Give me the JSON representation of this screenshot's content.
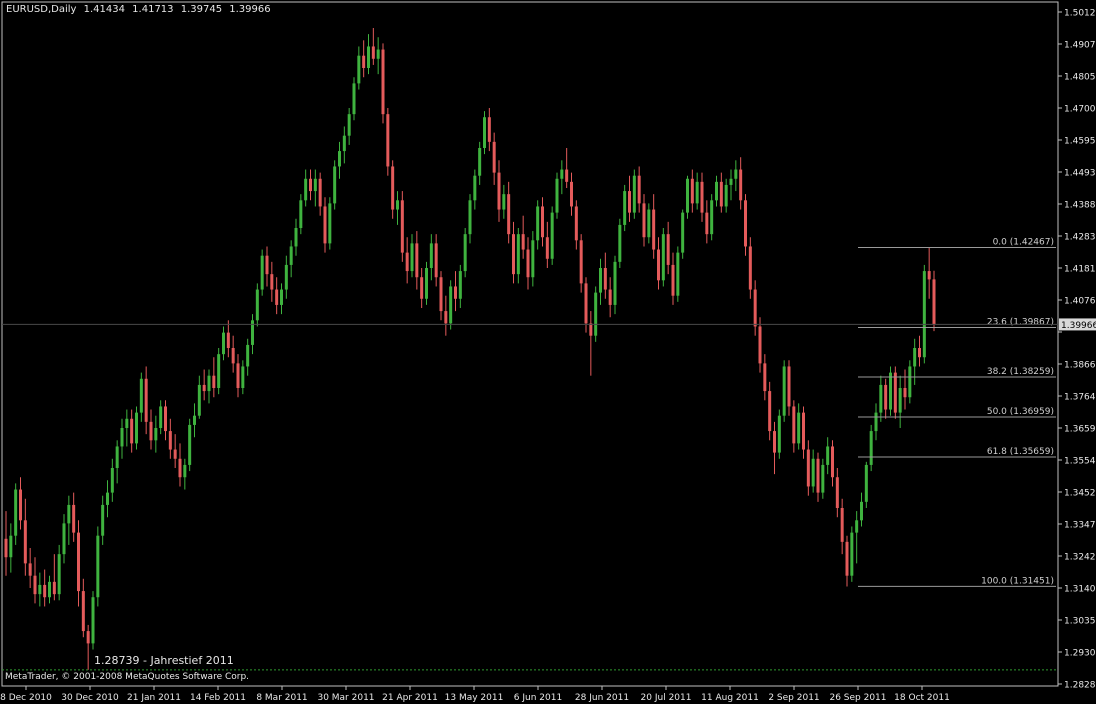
{
  "header": {
    "symbol": "EURUSD,Daily",
    "open": "1.41434",
    "high": "1.41713",
    "low": "1.39745",
    "close": "1.39966"
  },
  "footer": {
    "copyright": "MetaTrader, © 2001-2008 MetaQuotes Software Corp."
  },
  "annotation": {
    "low_label": "1.28739 - Jahrestief 2011"
  },
  "colors": {
    "background": "#000000",
    "bull": "#3fb33f",
    "bear": "#e45b5b",
    "axis": "#c0c0c0",
    "text": "#e8e8e8",
    "fib": "#9a9a9a"
  },
  "chart_data": {
    "type": "candlestick",
    "title": "EURUSD,Daily",
    "ylim": [
      1.2828,
      1.5012
    ],
    "y_ticks": [
      "1.50120",
      "1.49070",
      "1.48050",
      "1.47000",
      "1.45950",
      "1.44930",
      "1.43880",
      "1.42830",
      "1.41810",
      "1.40760",
      "1.39710",
      "1.38660",
      "1.37640",
      "1.36590",
      "1.35540",
      "1.34520",
      "1.33470",
      "1.32420",
      "1.31400",
      "1.30350",
      "1.29300",
      "1.28280"
    ],
    "x_ticks": [
      "8 Dec 2010",
      "30 Dec 2010",
      "21 Jan 2011",
      "14 Feb 2011",
      "8 Mar 2011",
      "30 Mar 2011",
      "21 Apr 2011",
      "13 May 2011",
      "6 Jun 2011",
      "28 Jun 2011",
      "20 Jul 2011",
      "11 Aug 2011",
      "2 Sep 2011",
      "26 Sep 2011",
      "18 Oct 2011"
    ],
    "current_price": "1.39966",
    "ohlc": [
      [
        1.33,
        1.339,
        1.318,
        1.324
      ],
      [
        1.324,
        1.335,
        1.319,
        1.331
      ],
      [
        1.331,
        1.348,
        1.328,
        1.346
      ],
      [
        1.346,
        1.35,
        1.333,
        1.336
      ],
      [
        1.336,
        1.343,
        1.318,
        1.322
      ],
      [
        1.322,
        1.327,
        1.314,
        1.318
      ],
      [
        1.318,
        1.324,
        1.309,
        1.312
      ],
      [
        1.312,
        1.319,
        1.308,
        1.315
      ],
      [
        1.315,
        1.32,
        1.308,
        1.311
      ],
      [
        1.311,
        1.318,
        1.309,
        1.316
      ],
      [
        1.316,
        1.325,
        1.31,
        1.312
      ],
      [
        1.312,
        1.328,
        1.31,
        1.325
      ],
      [
        1.325,
        1.338,
        1.322,
        1.335
      ],
      [
        1.335,
        1.344,
        1.328,
        1.341
      ],
      [
        1.341,
        1.345,
        1.329,
        1.332
      ],
      [
        1.332,
        1.336,
        1.308,
        1.313
      ],
      [
        1.313,
        1.317,
        1.298,
        1.3
      ],
      [
        1.3,
        1.302,
        1.2874,
        1.296
      ],
      [
        1.296,
        1.313,
        1.294,
        1.311
      ],
      [
        1.311,
        1.334,
        1.308,
        1.331
      ],
      [
        1.331,
        1.344,
        1.328,
        1.341
      ],
      [
        1.341,
        1.349,
        1.337,
        1.345
      ],
      [
        1.345,
        1.356,
        1.342,
        1.353
      ],
      [
        1.353,
        1.362,
        1.348,
        1.36
      ],
      [
        1.36,
        1.369,
        1.356,
        1.366
      ],
      [
        1.366,
        1.372,
        1.36,
        1.369
      ],
      [
        1.369,
        1.372,
        1.358,
        1.361
      ],
      [
        1.361,
        1.373,
        1.359,
        1.371
      ],
      [
        1.371,
        1.384,
        1.368,
        1.382
      ],
      [
        1.382,
        1.386,
        1.364,
        1.368
      ],
      [
        1.368,
        1.372,
        1.359,
        1.362
      ],
      [
        1.362,
        1.37,
        1.358,
        1.366
      ],
      [
        1.366,
        1.375,
        1.364,
        1.373
      ],
      [
        1.373,
        1.375,
        1.362,
        1.365
      ],
      [
        1.365,
        1.369,
        1.356,
        1.359
      ],
      [
        1.359,
        1.364,
        1.353,
        1.356
      ],
      [
        1.356,
        1.361,
        1.347,
        1.35
      ],
      [
        1.35,
        1.356,
        1.346,
        1.354
      ],
      [
        1.354,
        1.369,
        1.352,
        1.367
      ],
      [
        1.367,
        1.374,
        1.363,
        1.37
      ],
      [
        1.37,
        1.383,
        1.369,
        1.38
      ],
      [
        1.38,
        1.385,
        1.375,
        1.378
      ],
      [
        1.378,
        1.385,
        1.374,
        1.383
      ],
      [
        1.383,
        1.389,
        1.376,
        1.379
      ],
      [
        1.379,
        1.392,
        1.377,
        1.39
      ],
      [
        1.39,
        1.399,
        1.388,
        1.397
      ],
      [
        1.397,
        1.401,
        1.389,
        1.392
      ],
      [
        1.392,
        1.396,
        1.384,
        1.387
      ],
      [
        1.387,
        1.39,
        1.376,
        1.379
      ],
      [
        1.379,
        1.388,
        1.377,
        1.386
      ],
      [
        1.386,
        1.395,
        1.383,
        1.393
      ],
      [
        1.393,
        1.403,
        1.39,
        1.401
      ],
      [
        1.401,
        1.413,
        1.399,
        1.411
      ],
      [
        1.411,
        1.424,
        1.409,
        1.422
      ],
      [
        1.422,
        1.425,
        1.412,
        1.416
      ],
      [
        1.416,
        1.42,
        1.407,
        1.411
      ],
      [
        1.411,
        1.415,
        1.403,
        1.406
      ],
      [
        1.406,
        1.413,
        1.403,
        1.411
      ],
      [
        1.411,
        1.422,
        1.408,
        1.419
      ],
      [
        1.419,
        1.427,
        1.415,
        1.425
      ],
      [
        1.425,
        1.434,
        1.422,
        1.431
      ],
      [
        1.431,
        1.442,
        1.429,
        1.44
      ],
      [
        1.44,
        1.45,
        1.438,
        1.447
      ],
      [
        1.447,
        1.45,
        1.44,
        1.443
      ],
      [
        1.443,
        1.45,
        1.438,
        1.447
      ],
      [
        1.447,
        1.449,
        1.435,
        1.438
      ],
      [
        1.438,
        1.441,
        1.423,
        1.426
      ],
      [
        1.426,
        1.441,
        1.424,
        1.439
      ],
      [
        1.439,
        1.453,
        1.437,
        1.451
      ],
      [
        1.451,
        1.459,
        1.447,
        1.456
      ],
      [
        1.456,
        1.464,
        1.452,
        1.461
      ],
      [
        1.461,
        1.47,
        1.458,
        1.468
      ],
      [
        1.468,
        1.48,
        1.466,
        1.478
      ],
      [
        1.478,
        1.49,
        1.476,
        1.487
      ],
      [
        1.487,
        1.492,
        1.48,
        1.483
      ],
      [
        1.483,
        1.494,
        1.481,
        1.49
      ],
      [
        1.49,
        1.496,
        1.484,
        1.486
      ],
      [
        1.486,
        1.493,
        1.481,
        1.489
      ],
      [
        1.489,
        1.491,
        1.465,
        1.468
      ],
      [
        1.468,
        1.47,
        1.448,
        1.451
      ],
      [
        1.451,
        1.453,
        1.434,
        1.437
      ],
      [
        1.437,
        1.443,
        1.432,
        1.44
      ],
      [
        1.44,
        1.443,
        1.42,
        1.423
      ],
      [
        1.423,
        1.428,
        1.413,
        1.417
      ],
      [
        1.417,
        1.429,
        1.415,
        1.426
      ],
      [
        1.426,
        1.43,
        1.411,
        1.415
      ],
      [
        1.415,
        1.418,
        1.405,
        1.408
      ],
      [
        1.408,
        1.42,
        1.406,
        1.418
      ],
      [
        1.418,
        1.429,
        1.414,
        1.426
      ],
      [
        1.426,
        1.429,
        1.412,
        1.415
      ],
      [
        1.415,
        1.417,
        1.401,
        1.404
      ],
      [
        1.404,
        1.409,
        1.396,
        1.4
      ],
      [
        1.4,
        1.414,
        1.398,
        1.412
      ],
      [
        1.412,
        1.417,
        1.404,
        1.408
      ],
      [
        1.408,
        1.419,
        1.405,
        1.417
      ],
      [
        1.417,
        1.431,
        1.415,
        1.429
      ],
      [
        1.429,
        1.442,
        1.426,
        1.44
      ],
      [
        1.44,
        1.45,
        1.437,
        1.448
      ],
      [
        1.448,
        1.459,
        1.445,
        1.457
      ],
      [
        1.457,
        1.469,
        1.455,
        1.467
      ],
      [
        1.467,
        1.47,
        1.456,
        1.459
      ],
      [
        1.459,
        1.462,
        1.445,
        1.449
      ],
      [
        1.449,
        1.453,
        1.433,
        1.437
      ],
      [
        1.437,
        1.445,
        1.434,
        1.442
      ],
      [
        1.442,
        1.446,
        1.426,
        1.429
      ],
      [
        1.429,
        1.433,
        1.413,
        1.416
      ],
      [
        1.416,
        1.431,
        1.413,
        1.429
      ],
      [
        1.429,
        1.435,
        1.421,
        1.424
      ],
      [
        1.424,
        1.428,
        1.411,
        1.415
      ],
      [
        1.415,
        1.43,
        1.412,
        1.427
      ],
      [
        1.427,
        1.44,
        1.424,
        1.438
      ],
      [
        1.438,
        1.441,
        1.425,
        1.428
      ],
      [
        1.428,
        1.433,
        1.418,
        1.421
      ],
      [
        1.421,
        1.438,
        1.419,
        1.436
      ],
      [
        1.436,
        1.449,
        1.434,
        1.447
      ],
      [
        1.447,
        1.453,
        1.442,
        1.45
      ],
      [
        1.45,
        1.457,
        1.444,
        1.446
      ],
      [
        1.446,
        1.449,
        1.435,
        1.438
      ],
      [
        1.438,
        1.44,
        1.424,
        1.427
      ],
      [
        1.427,
        1.429,
        1.41,
        1.413
      ],
      [
        1.413,
        1.415,
        1.397,
        1.4
      ],
      [
        1.4,
        1.404,
        1.383,
        1.396
      ],
      [
        1.396,
        1.412,
        1.394,
        1.41
      ],
      [
        1.41,
        1.421,
        1.406,
        1.418
      ],
      [
        1.418,
        1.423,
        1.408,
        1.411
      ],
      [
        1.411,
        1.415,
        1.402,
        1.406
      ],
      [
        1.406,
        1.422,
        1.403,
        1.42
      ],
      [
        1.42,
        1.434,
        1.418,
        1.432
      ],
      [
        1.432,
        1.445,
        1.43,
        1.443
      ],
      [
        1.443,
        1.448,
        1.433,
        1.436
      ],
      [
        1.436,
        1.45,
        1.434,
        1.448
      ],
      [
        1.448,
        1.451,
        1.436,
        1.439
      ],
      [
        1.439,
        1.442,
        1.425,
        1.428
      ],
      [
        1.428,
        1.439,
        1.426,
        1.437
      ],
      [
        1.437,
        1.442,
        1.421,
        1.424
      ],
      [
        1.424,
        1.428,
        1.411,
        1.414
      ],
      [
        1.414,
        1.431,
        1.412,
        1.429
      ],
      [
        1.429,
        1.433,
        1.416,
        1.419
      ],
      [
        1.419,
        1.423,
        1.406,
        1.409
      ],
      [
        1.409,
        1.425,
        1.407,
        1.423
      ],
      [
        1.423,
        1.437,
        1.421,
        1.436
      ],
      [
        1.436,
        1.448,
        1.434,
        1.447
      ],
      [
        1.447,
        1.45,
        1.436,
        1.439
      ],
      [
        1.439,
        1.449,
        1.437,
        1.446
      ],
      [
        1.446,
        1.449,
        1.433,
        1.436
      ],
      [
        1.436,
        1.44,
        1.426,
        1.429
      ],
      [
        1.429,
        1.442,
        1.427,
        1.44
      ],
      [
        1.44,
        1.448,
        1.438,
        1.446
      ],
      [
        1.446,
        1.449,
        1.436,
        1.438
      ],
      [
        1.438,
        1.447,
        1.436,
        1.445
      ],
      [
        1.445,
        1.45,
        1.44,
        1.447
      ],
      [
        1.447,
        1.453,
        1.443,
        1.45
      ],
      [
        1.45,
        1.454,
        1.437,
        1.44
      ],
      [
        1.44,
        1.442,
        1.422,
        1.425
      ],
      [
        1.425,
        1.428,
        1.408,
        1.411
      ],
      [
        1.411,
        1.414,
        1.396,
        1.399
      ],
      [
        1.399,
        1.402,
        1.384,
        1.387
      ],
      [
        1.387,
        1.39,
        1.375,
        1.378
      ],
      [
        1.378,
        1.381,
        1.362,
        1.365
      ],
      [
        1.365,
        1.368,
        1.351,
        1.358
      ],
      [
        1.358,
        1.372,
        1.356,
        1.37
      ],
      [
        1.37,
        1.388,
        1.368,
        1.386
      ],
      [
        1.386,
        1.388,
        1.37,
        1.373
      ],
      [
        1.373,
        1.375,
        1.358,
        1.361
      ],
      [
        1.361,
        1.374,
        1.359,
        1.371
      ],
      [
        1.371,
        1.373,
        1.356,
        1.359
      ],
      [
        1.359,
        1.362,
        1.344,
        1.347
      ],
      [
        1.347,
        1.359,
        1.345,
        1.356
      ],
      [
        1.356,
        1.358,
        1.342,
        1.345
      ],
      [
        1.345,
        1.356,
        1.343,
        1.354
      ],
      [
        1.354,
        1.363,
        1.351,
        1.36
      ],
      [
        1.36,
        1.362,
        1.347,
        1.35
      ],
      [
        1.35,
        1.353,
        1.337,
        1.34
      ],
      [
        1.34,
        1.343,
        1.325,
        1.329
      ],
      [
        1.329,
        1.331,
        1.3145,
        1.318
      ],
      [
        1.318,
        1.334,
        1.316,
        1.332
      ],
      [
        1.332,
        1.339,
        1.322,
        1.336
      ],
      [
        1.336,
        1.345,
        1.334,
        1.342
      ],
      [
        1.342,
        1.355,
        1.34,
        1.354
      ],
      [
        1.354,
        1.367,
        1.352,
        1.365
      ],
      [
        1.365,
        1.374,
        1.362,
        1.371
      ],
      [
        1.371,
        1.383,
        1.368,
        1.38
      ],
      [
        1.38,
        1.382,
        1.369,
        1.372
      ],
      [
        1.372,
        1.386,
        1.37,
        1.384
      ],
      [
        1.384,
        1.386,
        1.369,
        1.371
      ],
      [
        1.371,
        1.383,
        1.366,
        1.379
      ],
      [
        1.379,
        1.385,
        1.372,
        1.376
      ],
      [
        1.376,
        1.388,
        1.374,
        1.386
      ],
      [
        1.386,
        1.395,
        1.38,
        1.392
      ],
      [
        1.392,
        1.396,
        1.386,
        1.389
      ],
      [
        1.389,
        1.419,
        1.387,
        1.417
      ],
      [
        1.417,
        1.4247,
        1.408,
        1.4143
      ],
      [
        1.4143,
        1.4171,
        1.3975,
        1.3997
      ]
    ],
    "fibonacci": [
      {
        "label": "0.0 (1.42467)",
        "value": 1.42467
      },
      {
        "label": "23.6 (1.39867)",
        "value": 1.39867
      },
      {
        "label": "38.2 (1.38259)",
        "value": 1.38259
      },
      {
        "label": "50.0 (1.36959)",
        "value": 1.36959
      },
      {
        "label": "61.8 (1.35659)",
        "value": 1.35659
      },
      {
        "label": "100.0 (1.31451)",
        "value": 1.31451
      }
    ],
    "low_level": 1.28739
  }
}
